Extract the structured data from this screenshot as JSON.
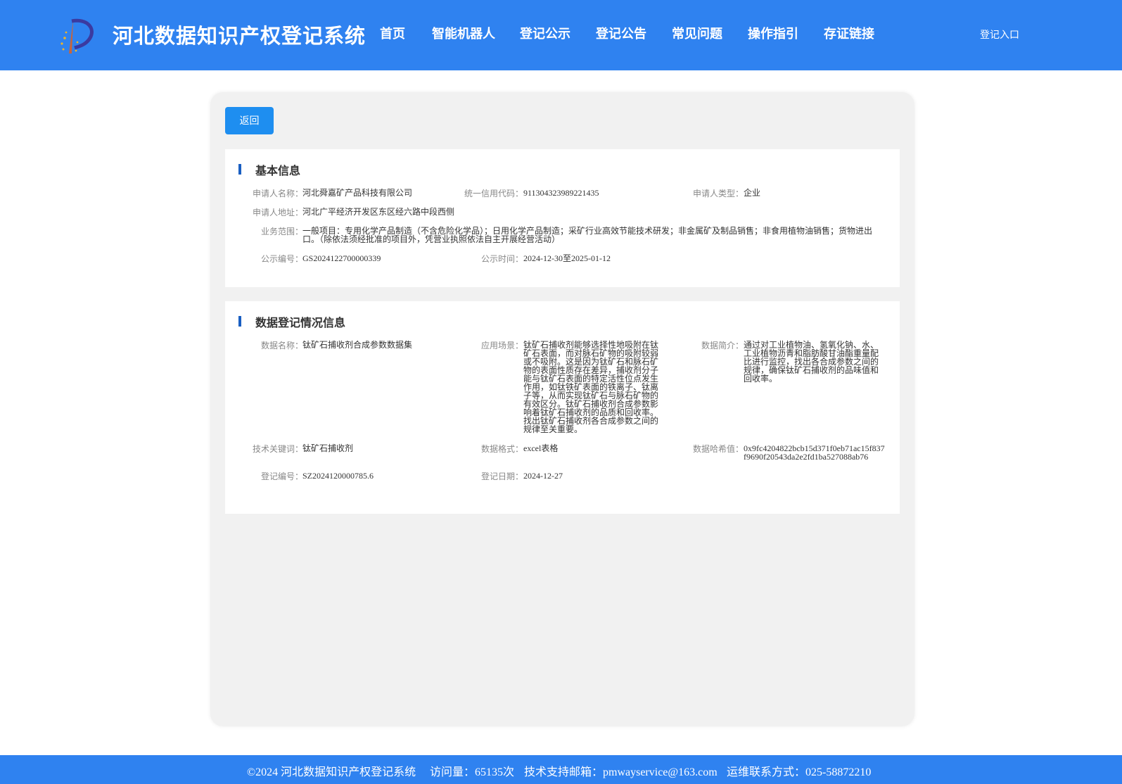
{
  "header": {
    "site_title": "河北数据知识产权登记系统",
    "nav": [
      "首页",
      "智能机器人",
      "登记公示",
      "登记公告",
      "常见问题",
      "操作指引",
      "存证链接"
    ],
    "login": "登记入口"
  },
  "toolbar": {
    "back_label": "返回"
  },
  "basic_info": {
    "title": "基本信息",
    "applicant_name": {
      "label": "申请人名称：",
      "value": "河北舜嘉矿产品科技有限公司"
    },
    "credit_code": {
      "label": "统一信用代码：",
      "value": "911304323989221435"
    },
    "applicant_type": {
      "label": "申请人类型：",
      "value": "企业"
    },
    "address": {
      "label": "申请人地址：",
      "value": "河北广平经济开发区东区经六路中段西侧"
    },
    "business_scope": {
      "label": "业务范围：",
      "value": "一般项目：专用化学产品制造（不含危险化学品）；日用化学产品制造；采矿行业高效节能技术研发；非金属矿及制品销售；非食用植物油销售；货物进出口。（除依法须经批准的项目外，凭营业执照依法自主开展经营活动）"
    },
    "notice_no": {
      "label": "公示编号：",
      "value": "GS2024122700000339"
    },
    "notice_time": {
      "label": "公示时间：",
      "value": "2024-12-30至2025-01-12"
    }
  },
  "data_info": {
    "title": "数据登记情况信息",
    "data_name": {
      "label": "数据名称：",
      "value": "钛矿石捕收剂合成参数数据集"
    },
    "scenario": {
      "label": "应用场景：",
      "value": "钛矿石捕收剂能够选择性地吸附在钛矿石表面，而对脉石矿物的吸附较弱或不吸附。这是因为钛矿石和脉石矿物的表面性质存在差异，捕收剂分子能与钛矿石表面的特定活性位点发生作用，如钛铁矿表面的铁离子、钛离子等，从而实现钛矿石与脉石矿物的有效区分。钛矿石捕收剂合成参数影响着钛矿石捕收剂的品质和回收率。找出钛矿石捕收剂各合成参数之间的规律至关重要。"
    },
    "summary": {
      "label": "数据简介：",
      "value": "通过对工业植物油、氢氧化钠、水、工业植物沥青和脂肪酸甘油酯重量配比进行监控，找出各合成参数之间的规律，确保钛矿石捕收剂的品味值和回收率。"
    },
    "keywords": {
      "label": "技术关键词：",
      "value": "钛矿石捕收剂"
    },
    "format": {
      "label": "数据格式：",
      "value": "excel表格"
    },
    "hash": {
      "label": "数据哈希值：",
      "value": "0x9fc4204822bcb15d371f0eb71ac15f837f9690f20543da2e2fd1ba527088ab76"
    },
    "reg_no": {
      "label": "登记编号：",
      "value": "SZ2024120000785.6"
    },
    "reg_date": {
      "label": "登记日期：",
      "value": "2024-12-27"
    }
  },
  "footer": {
    "copyright": "©2024 河北数据知识产权登记系统",
    "visits": "访问量：65135次",
    "support": "技术支持邮箱：pmwayservice@163.com",
    "contact": "运维联系方式：025-58872210"
  },
  "colors": {
    "brand": "#2f82f0",
    "button": "#1e8ef0",
    "section_bar": "#1a5fc2"
  }
}
